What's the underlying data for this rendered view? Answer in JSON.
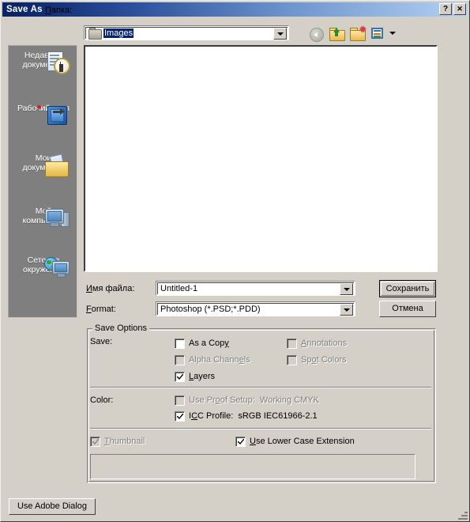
{
  "window": {
    "title": "Save As",
    "help_button": "?",
    "close_button": "✕",
    "resize_grip_icon": "resize-grip-icon"
  },
  "toolbar": {
    "folder_label": "Папка:",
    "folder_label_accel": "П",
    "current_folder": "Images",
    "folder_icon": "folder-icon",
    "combo_arrow_icon": "chevron-down-icon",
    "nav": [
      {
        "name": "back-button",
        "icon": "back-arrow-icon",
        "label": "",
        "disabled": true
      },
      {
        "name": "up-one-level-button",
        "icon": "up-folder-icon",
        "label": "",
        "disabled": false
      },
      {
        "name": "new-folder-button",
        "icon": "new-folder-icon",
        "label": "",
        "disabled": false
      },
      {
        "name": "views-button",
        "icon": "views-grid-icon",
        "label": "",
        "disabled": false
      }
    ]
  },
  "places": {
    "items": [
      {
        "label_line1": "Недавние",
        "label_line2": "документы",
        "icon": "recent-documents-icon"
      },
      {
        "label_line1": "Рабочий стол",
        "label_line2": "",
        "icon": "desktop-icon"
      },
      {
        "label_line1": "Мои",
        "label_line2": "документы",
        "icon": "my-documents-icon"
      },
      {
        "label_line1": "Мой",
        "label_line2": "компьютер",
        "icon": "my-computer-icon"
      },
      {
        "label_line1": "Сетевое",
        "label_line2": "окружение",
        "icon": "network-places-icon"
      }
    ]
  },
  "filelist": {
    "items": [],
    "empty": true
  },
  "fields": {
    "filename_label": "Имя файла:",
    "filename_value": "Untitled-1",
    "format_label": "Format:",
    "format_value": "Photoshop (*.PSD;*.PDD)"
  },
  "buttons": {
    "save": "Сохранить",
    "cancel": "Отмена",
    "use_adobe_dialog": "Use Adobe Dialog"
  },
  "save_options": {
    "group_title": "Save Options",
    "save_row_label": "Save:",
    "color_row_label": "Color:",
    "checkboxes": {
      "as_a_copy": {
        "label": "As a Copy",
        "checked": false,
        "disabled": false
      },
      "alpha_channels": {
        "label": "Alpha Channels",
        "checked": false,
        "disabled": true
      },
      "layers": {
        "label": "Layers",
        "checked": true,
        "disabled": false
      },
      "annotations": {
        "label": "Annotations",
        "checked": false,
        "disabled": true
      },
      "spot_colors": {
        "label": "Spot Colors",
        "checked": false,
        "disabled": true
      },
      "use_proof_setup": {
        "label": "Use Proof Setup:  Working CMYK",
        "checked": false,
        "disabled": true
      },
      "icc_profile": {
        "label": "ICC Profile:  sRGB IEC61966-2.1",
        "checked": true,
        "disabled": false
      },
      "thumbnail": {
        "label": "Thumbnail",
        "checked": true,
        "disabled": true
      },
      "use_lower_case_extension": {
        "label": "Use Lower Case Extension",
        "checked": true,
        "disabled": false
      }
    }
  },
  "colors": {
    "dialog_face": "#d4d0c8",
    "titlebar_start": "#0a246a",
    "titlebar_end": "#a8c8ec",
    "places_bar": "#7f7f7f",
    "selection": "#0a246a",
    "disabled_text": "#808080",
    "field_bg": "#ffffff"
  }
}
